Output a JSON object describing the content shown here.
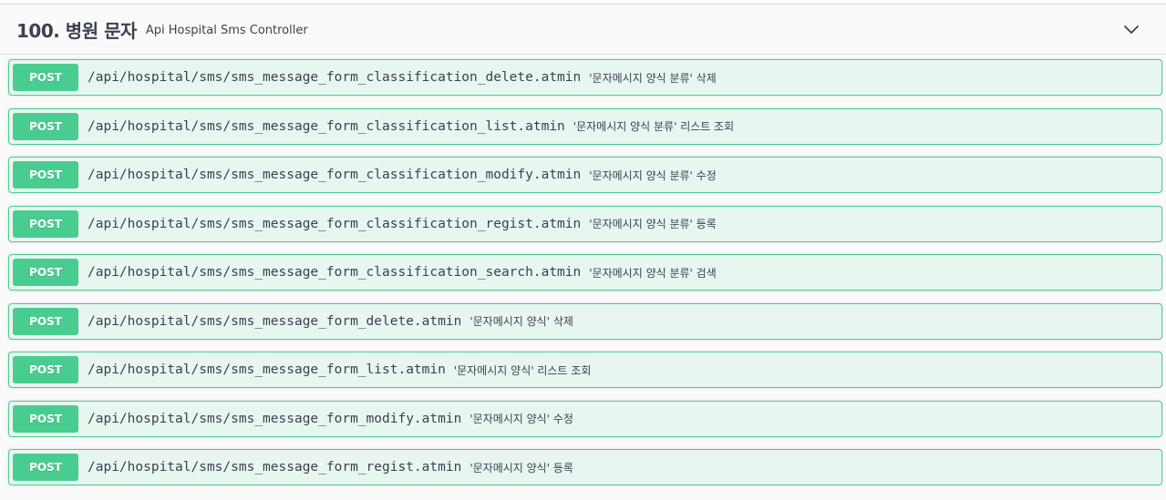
{
  "tag": {
    "title": "100. 병원 문자",
    "description": "Api Hospital Sms Controller",
    "expand_icon": "chevron-down-icon"
  },
  "colors": {
    "post_accent": "#49cc90",
    "post_background": "#e8f6f0",
    "text": "#3b4151"
  },
  "operations": [
    {
      "method": "POST",
      "path": "/api/hospital/sms/sms_message_form_classification_delete.atmin",
      "summary": "'문자메시지 양식 분류' 삭제"
    },
    {
      "method": "POST",
      "path": "/api/hospital/sms/sms_message_form_classification_list.atmin",
      "summary": "'문자메시지 양식 분류' 리스트 조회"
    },
    {
      "method": "POST",
      "path": "/api/hospital/sms/sms_message_form_classification_modify.atmin",
      "summary": "'문자메시지 양식 분류' 수정"
    },
    {
      "method": "POST",
      "path": "/api/hospital/sms/sms_message_form_classification_regist.atmin",
      "summary": "'문자메시지 양식 분류' 등록"
    },
    {
      "method": "POST",
      "path": "/api/hospital/sms/sms_message_form_classification_search.atmin",
      "summary": "'문자메시지 양식 분류' 검색"
    },
    {
      "method": "POST",
      "path": "/api/hospital/sms/sms_message_form_delete.atmin",
      "summary": "'문자메시지 양식' 삭제"
    },
    {
      "method": "POST",
      "path": "/api/hospital/sms/sms_message_form_list.atmin",
      "summary": "'문자메시지 양식' 리스트 조회"
    },
    {
      "method": "POST",
      "path": "/api/hospital/sms/sms_message_form_modify.atmin",
      "summary": "'문자메시지 양식' 수정"
    },
    {
      "method": "POST",
      "path": "/api/hospital/sms/sms_message_form_regist.atmin",
      "summary": "'문자메시지 양식' 등록"
    }
  ]
}
